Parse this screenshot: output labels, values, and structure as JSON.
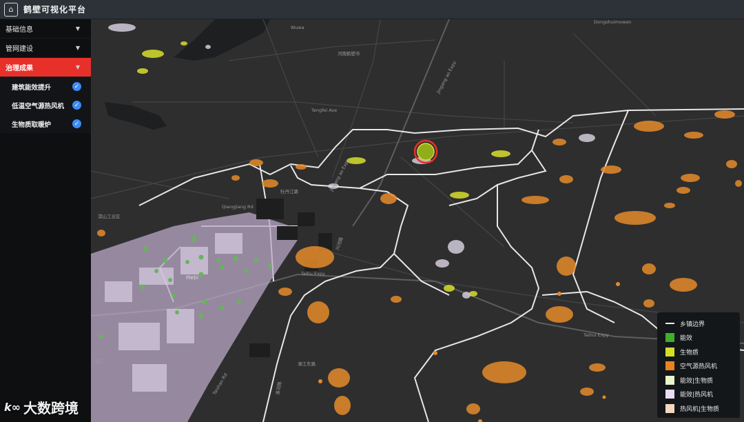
{
  "app": {
    "title": "鹤壁可视化平台",
    "logo_icon": "building-logo-icon"
  },
  "sidebar": {
    "menus": [
      {
        "label": "基础信息",
        "active": false
      },
      {
        "label": "管网建设",
        "active": false
      },
      {
        "label": "治理成果",
        "active": true
      }
    ],
    "sub_items": [
      {
        "label": "建筑能效提升",
        "checked": true
      },
      {
        "label": "低温空气源热风机",
        "checked": true
      },
      {
        "label": "生物质取暖炉",
        "checked": true
      }
    ]
  },
  "map_labels": {
    "wuwa": "Wuwa",
    "dongshuimowan": "Dongshuimowan",
    "henan_office": "河南鹤壁市",
    "tengfei_ave": "Tengfei Ave",
    "jingang_expy": "Jingang ao Expy",
    "jingang_expy2": "Jingang ao Expy",
    "mudan_rd": "牡丹江路",
    "qiangjiang_rd": "Qiangjiang Rd",
    "qishan_park": "淇山工业区",
    "hebi": "Hebi",
    "taihu_expy": "Taihu Expy",
    "taihu_expy2": "Taihui Expy",
    "lijiang_rd": "漓江东路",
    "taishan_rd": "Taishan Rd",
    "huaihe_rd": "淮河路",
    "qi_river": "淇江",
    "xinghe_rd": "兴河路"
  },
  "legend": {
    "items": [
      {
        "label": "乡镇边界",
        "type": "line",
        "color": "#eeeeee"
      },
      {
        "label": "能效",
        "type": "box",
        "color": "#3fae2a"
      },
      {
        "label": "生物质",
        "type": "box",
        "color": "#d6dd25"
      },
      {
        "label": "空气源热风机",
        "type": "box",
        "color": "#e6841f"
      },
      {
        "label": "能效|生物质",
        "type": "box",
        "color": "#e9f5c6"
      },
      {
        "label": "能效|热风机",
        "type": "box",
        "color": "#e9dcf3"
      },
      {
        "label": "热风机|生物质",
        "type": "box",
        "color": "#f3d8c0"
      }
    ]
  },
  "watermark": {
    "text": "大数跨境",
    "icon": "k-logo-icon"
  }
}
